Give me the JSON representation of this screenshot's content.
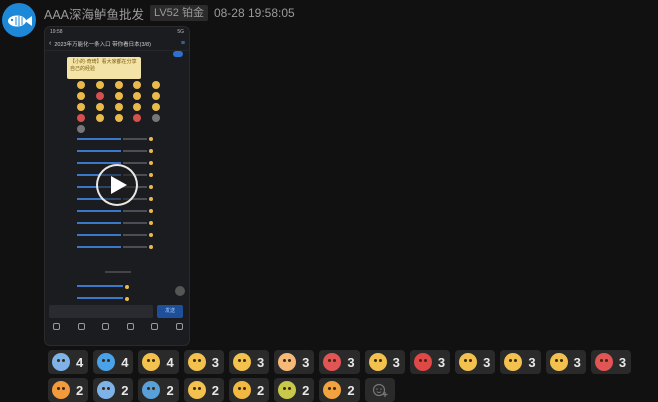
{
  "message": {
    "sender": "AAA深海鲈鱼批发",
    "level_badge": "LV52 铂金",
    "timestamp": "08-28 19:58:05",
    "avatar_icon": "fish-icon",
    "avatar_color": "#1e88d8"
  },
  "video": {
    "phone_status_time": "19:58",
    "phone_status_right": "5G",
    "phone_title": "2023年万能化一条入口 带你看日本(3/8)",
    "bubble_text": "【小的·奇琦】看大家都在分享自己的经验",
    "send_label": "发送",
    "play_icon": "play-icon"
  },
  "reactions": [
    {
      "icon": "cold-sweat-face-icon",
      "color": "#7fb2e6",
      "count": "4"
    },
    {
      "icon": "sweat-droplets-icon",
      "color": "#4aa3e8",
      "count": "4"
    },
    {
      "icon": "surprised-face-icon",
      "color": "#f2c14e",
      "count": "4"
    },
    {
      "icon": "tears-of-joy-icon",
      "color": "#f2c14e",
      "count": "3"
    },
    {
      "icon": "downcast-sweat-face-icon",
      "color": "#f2c14e",
      "count": "3"
    },
    {
      "icon": "pig-face-icon",
      "color": "#f5b97a",
      "count": "3"
    },
    {
      "icon": "red-angry-face-icon",
      "color": "#e25555",
      "count": "3"
    },
    {
      "icon": "anxious-face-icon",
      "color": "#f2c14e",
      "count": "3"
    },
    {
      "icon": "angry-devil-icon",
      "color": "#e04848",
      "count": "3"
    },
    {
      "icon": "smirk-face-icon",
      "color": "#f2c14e",
      "count": "3"
    },
    {
      "icon": "teary-face-icon",
      "color": "#f2c14e",
      "count": "3"
    },
    {
      "icon": "monocle-face-icon",
      "color": "#f2c14e",
      "count": "3"
    },
    {
      "icon": "watermelon-icon",
      "color": "#e25555",
      "count": "3"
    },
    {
      "icon": "blush-hug-face-icon",
      "color": "#f29a3e",
      "count": "2"
    },
    {
      "icon": "loudly-crying-face-icon",
      "color": "#7fb2e6",
      "count": "2"
    },
    {
      "icon": "fish-bowl-icon",
      "color": "#5aa0d8",
      "count": "2"
    },
    {
      "icon": "staring-face-icon",
      "color": "#f2c14e",
      "count": "2"
    },
    {
      "icon": "toast-bread-icon",
      "color": "#f2b942",
      "count": "2"
    },
    {
      "icon": "ghost-face-icon",
      "color": "#c8c84a",
      "count": "2"
    },
    {
      "icon": "raised-fist-icon",
      "color": "#f2a23e",
      "count": "2"
    }
  ],
  "add_reaction_icon": "add-emoji-icon"
}
